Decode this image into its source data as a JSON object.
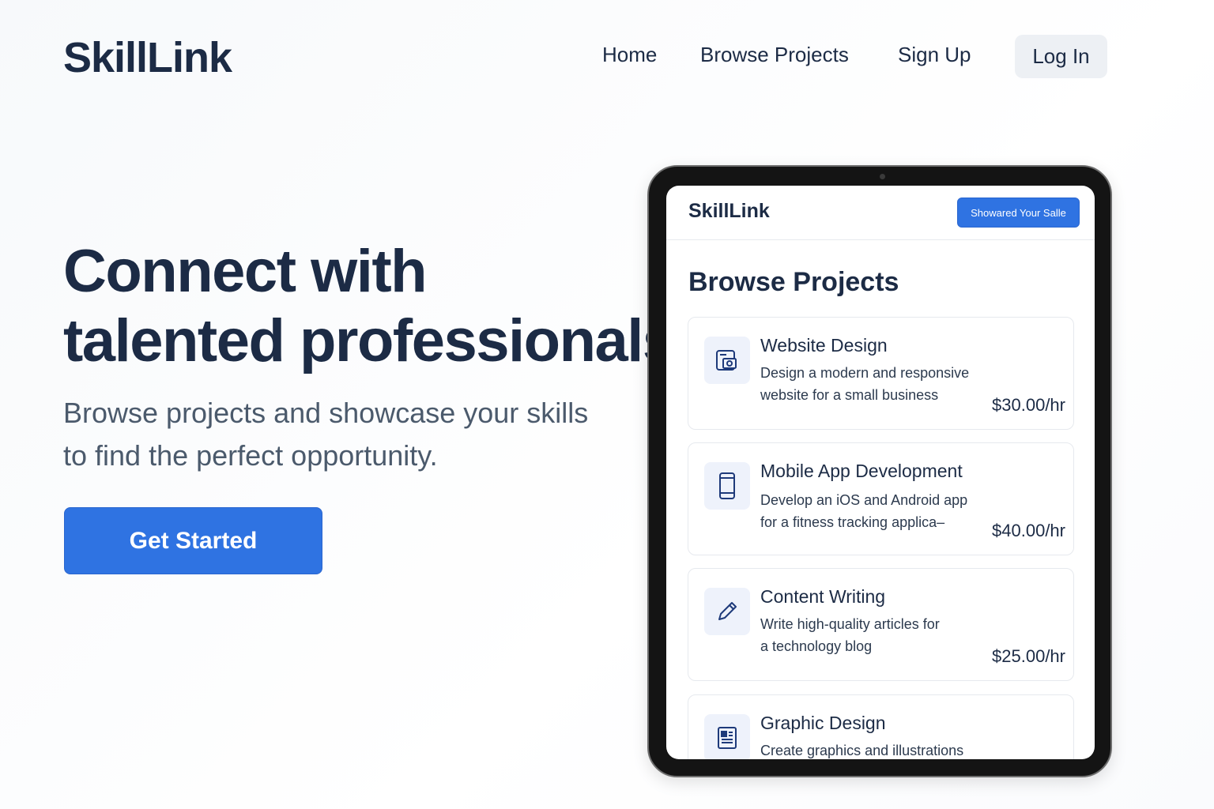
{
  "header": {
    "brand": "SkillLink",
    "nav": {
      "home": "Home",
      "browse": "Browse Projects",
      "signup": "Sign Up",
      "login": "Log In"
    }
  },
  "hero": {
    "title_line1": "Connect with",
    "title_line2": "talented professionals",
    "subtitle_line1": "Browse projects and showcase your skills",
    "subtitle_line2": "to find the perfect opportunity.",
    "cta": "Get Started"
  },
  "tablet": {
    "brand": "SkillLink",
    "header_button": "Showared Your Salle",
    "heading": "Browse Projects",
    "projects": [
      {
        "title": "Website Design",
        "desc_line1": "Design a modern and responsive",
        "desc_line2": "website for a small business",
        "price": "$30.00/hr",
        "icon": "web-design-icon"
      },
      {
        "title": "Mobile App Development",
        "desc_line1": "Develop an iOS and Android app",
        "desc_line2": "for a fitness tracking applica–",
        "price": "$40.00/hr",
        "icon": "mobile-phone-icon"
      },
      {
        "title": "Content Writing",
        "desc_line1": "Write high-quality articles for",
        "desc_line2": "a technology blog",
        "price": "$25.00/hr",
        "icon": "pencil-icon"
      },
      {
        "title": "Graphic Design",
        "desc_line1": "Create graphics and illustrations",
        "desc_line2": "",
        "price": "",
        "icon": "graphic-design-icon"
      }
    ]
  },
  "colors": {
    "primary": "#2f73e2",
    "text_dark": "#1c2b45",
    "text_muted": "#4b5a6c"
  }
}
